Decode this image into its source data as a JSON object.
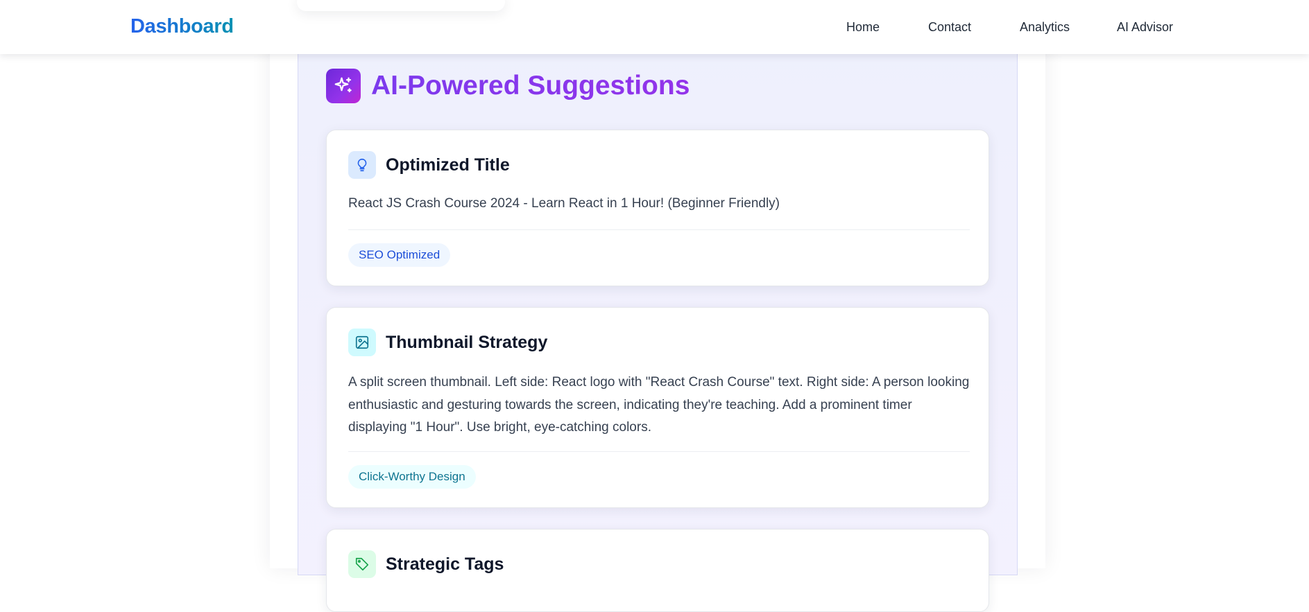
{
  "nav": {
    "brand": "Dashboard",
    "links": [
      "Home",
      "Contact",
      "Analytics",
      "AI Advisor"
    ]
  },
  "section": {
    "title": "AI-Powered Suggestions",
    "icon": "sparkles-icon"
  },
  "cards": [
    {
      "icon": "lightbulb-icon",
      "title": "Optimized Title",
      "body": "React JS Crash Course 2024 - Learn React in 1 Hour! (Beginner Friendly)",
      "badge": "SEO Optimized"
    },
    {
      "icon": "image-icon",
      "title": "Thumbnail Strategy",
      "body": "A split screen thumbnail. Left side: React logo with \"React Crash Course\" text. Right side: A person looking enthusiastic and gesturing towards the screen, indicating they're teaching. Add a prominent timer displaying \"1 Hour\". Use bright, eye-catching colors.",
      "badge": "Click-Worthy Design"
    },
    {
      "icon": "tag-icon",
      "title": "Strategic Tags"
    }
  ],
  "colors": {
    "brand_gradient": [
      "#2563eb",
      "#0891b2"
    ],
    "accent_purple": "#7c3aed",
    "panel_bg": "#eef0fd"
  }
}
